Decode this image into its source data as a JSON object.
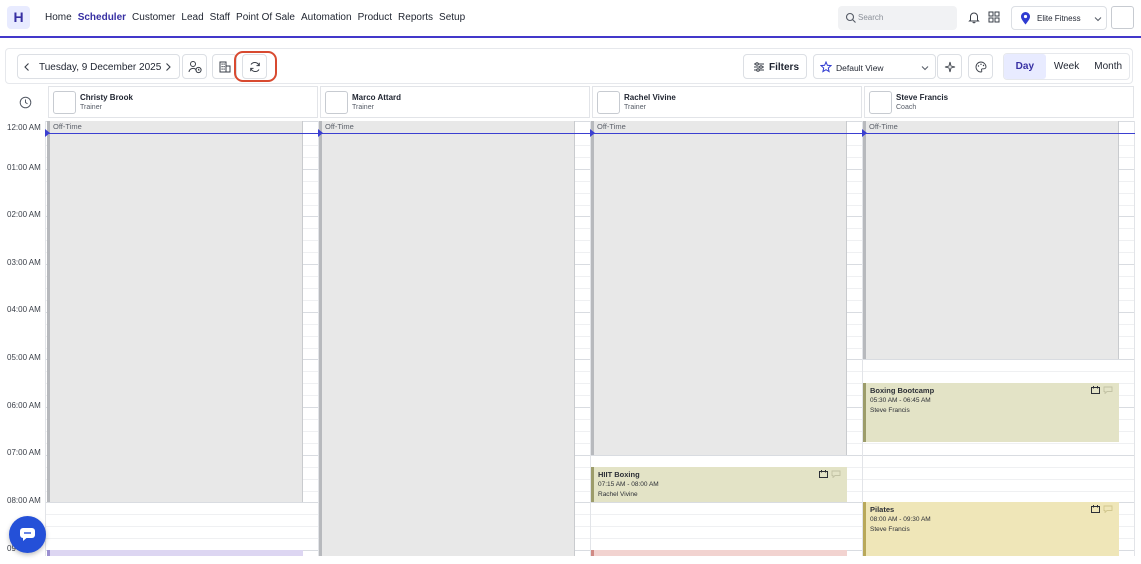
{
  "app": {
    "logo_letter": "H"
  },
  "nav": {
    "items": [
      "Home",
      "Scheduler",
      "Customer",
      "Lead",
      "Staff",
      "Point Of Sale",
      "Automation",
      "Product",
      "Reports",
      "Setup"
    ],
    "active": "Scheduler"
  },
  "search": {
    "placeholder": "Search"
  },
  "location": {
    "name": "Elite Fitness"
  },
  "toolbar": {
    "date": "Tuesday, 9 December 2025",
    "filters_label": "Filters",
    "view_select": "Default View",
    "views": [
      "Day",
      "Week",
      "Month"
    ],
    "active_view": "Day"
  },
  "staff": [
    {
      "name": "Christy Brook",
      "role": "Trainer"
    },
    {
      "name": "Marco Attard",
      "role": "Trainer"
    },
    {
      "name": "Rachel Vivine",
      "role": "Trainer"
    },
    {
      "name": "Steve Francis",
      "role": "Coach"
    }
  ],
  "hours": [
    "12:00 AM",
    "01:00 AM",
    "02:00 AM",
    "03:00 AM",
    "04:00 AM",
    "05:00 AM",
    "06:00 AM",
    "07:00 AM",
    "08:00 AM",
    "09"
  ],
  "offtime_label": "Off-Time",
  "events": [
    {
      "title": "Boxing Bootcamp",
      "time": "05:30 AM - 06:45 AM",
      "staff": "Steve Francis"
    },
    {
      "title": "HIIT Boxing",
      "time": "07:15 AM - 08:00 AM",
      "staff": "Rachel Vivine"
    },
    {
      "title": "Pilates",
      "time": "08:00 AM - 09:30 AM",
      "staff": "Steve Francis"
    }
  ],
  "colors": {
    "accent": "#3730a3",
    "event_olive": "#e3e3c6",
    "event_yellow": "#efe6b8",
    "offtime": "#e8e8e8",
    "highlight_ring": "#d84a30",
    "chat": "#2450d8"
  }
}
